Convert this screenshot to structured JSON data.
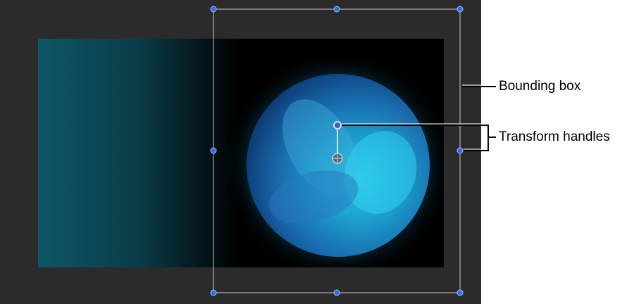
{
  "callouts": {
    "bounding_box": "Bounding box",
    "transform_handles": "Transform handles"
  },
  "colors": {
    "canvas_bg": "#2b2b2b",
    "handle_blue": "#2f6fe8",
    "bbox_line": "#c8c8c8"
  }
}
